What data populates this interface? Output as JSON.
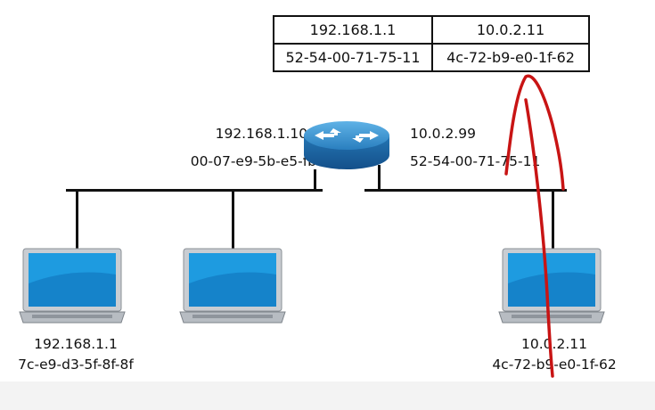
{
  "arp_table": {
    "rows": [
      {
        "left": "192.168.1.1",
        "right": "10.0.2.11"
      },
      {
        "left": "52-54-00-71-75-11",
        "right": "4c-72-b9-e0-1f-62"
      }
    ]
  },
  "router": {
    "left_ip": "192.168.1.100",
    "left_mac": "00-07-e9-5b-e5-fb",
    "right_ip": "10.0.2.99",
    "right_mac": "52-54-00-71-75-11",
    "icon": "router-icon"
  },
  "hosts": [
    {
      "ip": "192.168.1.1",
      "mac": "7c-e9-d3-5f-8f-8f",
      "icon": "laptop-icon"
    },
    {
      "icon": "laptop-icon"
    },
    {
      "ip": "10.0.2.11",
      "mac": "4c-72-b9-e0-1f-62",
      "icon": "laptop-icon"
    }
  ],
  "colors": {
    "annotation": "#c81414",
    "router_body": "#2a7fbf",
    "screen": "#1e9be0"
  }
}
